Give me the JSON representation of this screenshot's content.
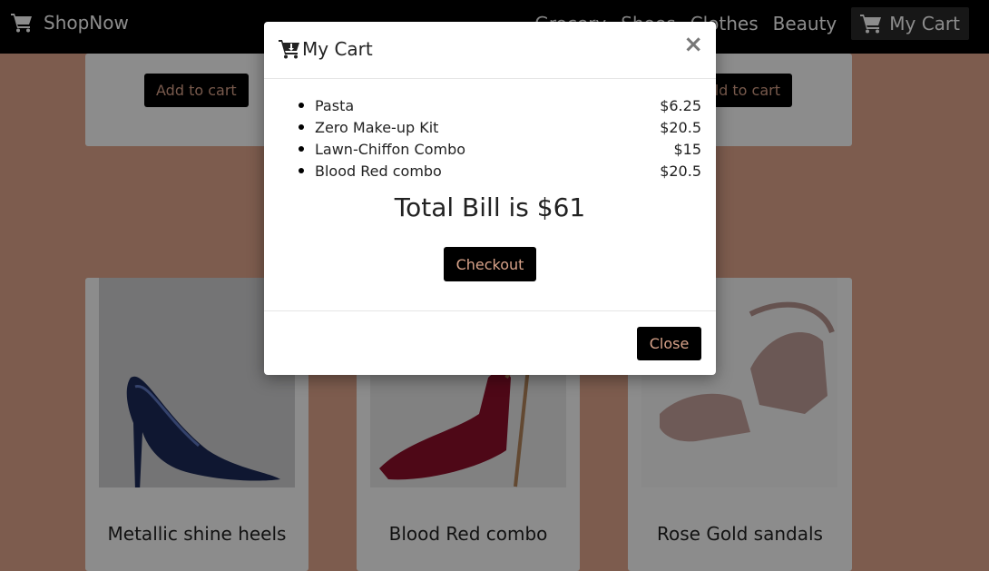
{
  "brand": {
    "name": "ShopNow",
    "icon": "shopping-cart-icon"
  },
  "nav": {
    "links": [
      "Grocery",
      "Shoes",
      "Clothes",
      "Beauty"
    ],
    "cart_label": "My Cart"
  },
  "page": {
    "top_cards": {
      "add_to_cart_label": "Add to cart",
      "add_to_cart_right_partial": "ld to cart"
    },
    "products": [
      {
        "name": "Metallic shine heels"
      },
      {
        "name": "Blood Red combo"
      },
      {
        "name": "Rose Gold sandals"
      }
    ]
  },
  "modal": {
    "title": "My Cart",
    "close_symbol": "×",
    "items": [
      {
        "name": "Pasta",
        "price": "$6.25"
      },
      {
        "name": "Zero Make-up Kit",
        "price": "$20.5"
      },
      {
        "name": "Lawn-Chiffon Combo",
        "price": "$15"
      },
      {
        "name": "Blood Red combo",
        "price": "$20.5"
      }
    ],
    "total_text": "Total Bill is $61",
    "checkout_label": "Checkout",
    "close_label": "Close"
  },
  "colors": {
    "background": "#e3a88e",
    "navbar": "#000000",
    "button": "#000000",
    "button_text": "#d9a38a"
  }
}
